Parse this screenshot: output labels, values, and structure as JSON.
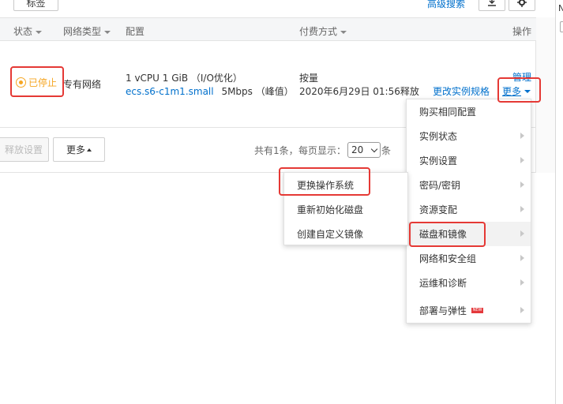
{
  "toolbar": {
    "tag_button": "标签",
    "advanced_search": "高级搜索"
  },
  "table": {
    "headers": {
      "status": "状态",
      "network_type": "网络类型",
      "config": "配置",
      "billing": "付费方式",
      "actions": "操作"
    },
    "row": {
      "status": "已停止",
      "network": "专有网络",
      "config_line1": "1 vCPU 1 GiB （I/O优化）",
      "instance_type": "ecs.s6-c1m1.small",
      "bandwidth": "5Mbps （峰值）",
      "billing_line1": "按量",
      "billing_line2": "2020年6月29日 01:56释放",
      "change_spec": "更改实例规格",
      "manage": "管理",
      "more": "更多"
    }
  },
  "footer": {
    "release_settings": "释放设置",
    "more": "更多",
    "total": "共有1条，",
    "per_page_label": "每页显示：",
    "per_page_value": "20",
    "unit": "条"
  },
  "main_menu": {
    "items": [
      {
        "label": "购买相同配置",
        "submenu": false
      },
      {
        "label": "实例状态",
        "submenu": true
      },
      {
        "label": "实例设置",
        "submenu": true
      },
      {
        "label": "密码/密钥",
        "submenu": true
      },
      {
        "label": "资源变配",
        "submenu": true
      },
      {
        "label": "磁盘和镜像",
        "submenu": true
      },
      {
        "label": "网络和安全组",
        "submenu": true
      },
      {
        "label": "运维和诊断",
        "submenu": true
      },
      {
        "label": "部署与弹性",
        "submenu": true
      }
    ],
    "new_badge": "NEW"
  },
  "sub_menu": {
    "items": [
      {
        "label": "更换操作系统"
      },
      {
        "label": "重新初始化磁盘"
      },
      {
        "label": "创建自定义镜像"
      }
    ]
  },
  "right_panel": {
    "edge_text": "N"
  },
  "colors": {
    "link": "#0070cc",
    "stopped": "#f5a623",
    "highlight": "#e53935"
  }
}
